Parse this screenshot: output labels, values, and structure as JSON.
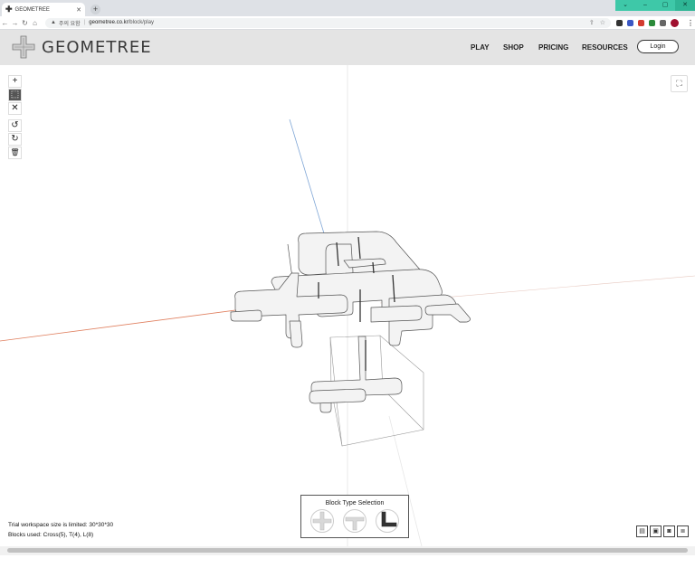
{
  "browser": {
    "tab_title": "GEOMETREE",
    "tab_icon": "plus-favicon-icon",
    "security_label": "주의 요함",
    "url_host": "geometree.co.kr",
    "url_path": "/block/play"
  },
  "header": {
    "logo_text": "GEOMETREE",
    "nav": [
      "PLAY",
      "SHOP",
      "PRICING",
      "RESOURCES"
    ],
    "login_label": "Login"
  },
  "toolbar": {
    "tools": [
      {
        "name": "add-tool",
        "icon": "plus-icon",
        "glyph": "+"
      },
      {
        "name": "select-tool",
        "icon": "cursor-icon",
        "glyph": "⬚",
        "active": true
      },
      {
        "name": "delete-tool",
        "icon": "close-icon",
        "glyph": "✕"
      },
      {
        "name": "undo-tool",
        "icon": "undo-icon",
        "glyph": "↺"
      },
      {
        "name": "redo-tool",
        "icon": "redo-icon",
        "glyph": "↻"
      },
      {
        "name": "trash-tool",
        "icon": "trash-icon",
        "glyph": "🗑"
      }
    ]
  },
  "workspace": {
    "limit_text": "Trial workspace size is limited: 30*30*30",
    "blocks_used_text": "Blocks used: Cross(5), T(4), L(8)"
  },
  "block_selection": {
    "title": "Block Type Selection",
    "types": [
      {
        "name": "cross-block",
        "selected": false
      },
      {
        "name": "t-block",
        "selected": false
      },
      {
        "name": "l-block",
        "selected": true
      }
    ]
  },
  "bottom_tools": [
    {
      "name": "open-icon",
      "glyph": "▤"
    },
    {
      "name": "save-icon",
      "glyph": "▣"
    },
    {
      "name": "camera-icon",
      "glyph": "◙"
    },
    {
      "name": "document-icon",
      "glyph": "≣"
    }
  ],
  "colors": {
    "header_bg": "#e4e4e4",
    "axis_x": "#e08060",
    "axis_z": "#7fa6d6",
    "block_fill": "#f3f3f3",
    "accent_window": "#3ec8a8"
  }
}
